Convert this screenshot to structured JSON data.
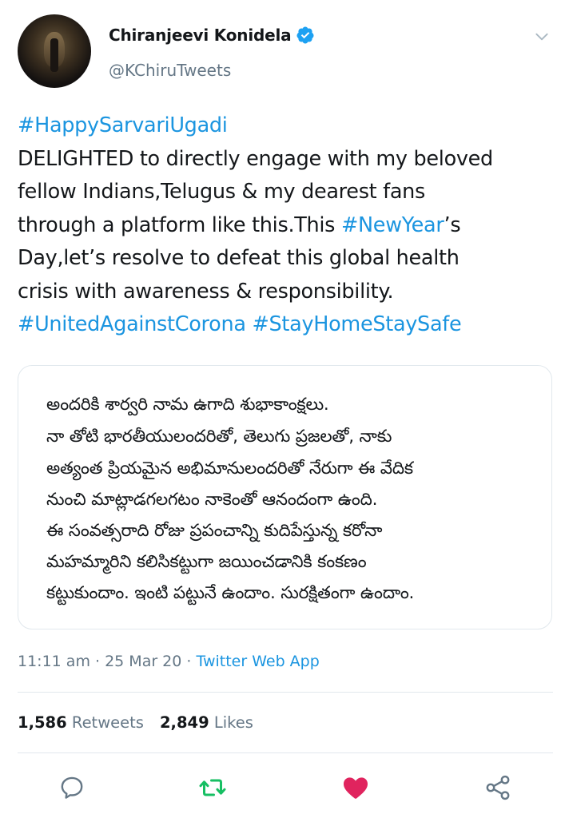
{
  "tweet": {
    "author_name": "Chiranjeevi Konidela",
    "handle": "@KChiruTweets",
    "text_lines": [
      [
        {
          "t": "#HappySarvariUgadi",
          "tag": true
        }
      ],
      [
        {
          "t": "DELIGHTED to directly engage with my beloved",
          "tag": false
        }
      ],
      [
        {
          "t": "fellow Indians,Telugus & my dearest fans",
          "tag": false
        }
      ],
      [
        {
          "t": "through a platform like this.This ",
          "tag": false
        },
        {
          "t": "#NewYear",
          "tag": true
        },
        {
          "t": "’s",
          "tag": false
        }
      ],
      [
        {
          "t": "Day,let’s resolve to defeat this global health",
          "tag": false
        }
      ],
      [
        {
          "t": "crisis with awareness & responsibility.",
          "tag": false
        }
      ],
      [
        {
          "t": "#UnitedAgainstCorona",
          "tag": true
        },
        {
          "t": " ",
          "tag": false
        },
        {
          "t": "#StayHomeStaySafe",
          "tag": true
        }
      ]
    ],
    "quote_lines": [
      "అందరికి శార్వరి నామ ఉగాది శుభాకాంక్షలు.",
      "నా తోటి భారతీయులందరితో, తెలుగు ప్రజలతో, నాకు",
      "అత్యంత ప్రియమైన అభిమానులందరితో నేరుగా ఈ వేదిక",
      "నుంచి మాట్లాడగలగటం నాకెంతో ఆనందంగా ఉంది.",
      "ఈ సంవత్సరాది రోజు ప్రపంచాన్ని కుదిపేస్తున్న కరోనా",
      "మహమ్మారిని కలిసికట్టుగా జయించడానికి కంకణం",
      "కట్టుకుందాం. ఇంటి పట్టునే ఉందాం. సురక్షితంగా ఉందాం."
    ],
    "time": "11:11 am",
    "date": "25 Mar 20",
    "separator": " · ",
    "source_app": "Twitter Web App",
    "retweets_count": "1,586",
    "retweets_label": "Retweets",
    "likes_count": "2,849",
    "likes_label": "Likes"
  },
  "colors": {
    "link": "#1b95e0",
    "retweet_active": "#17bf63",
    "like_active": "#e0245e",
    "secondary_text": "#657786"
  },
  "icons": [
    "verified-badge-icon",
    "chevron-down-icon",
    "reply-icon",
    "retweet-icon",
    "like-icon",
    "share-icon"
  ]
}
